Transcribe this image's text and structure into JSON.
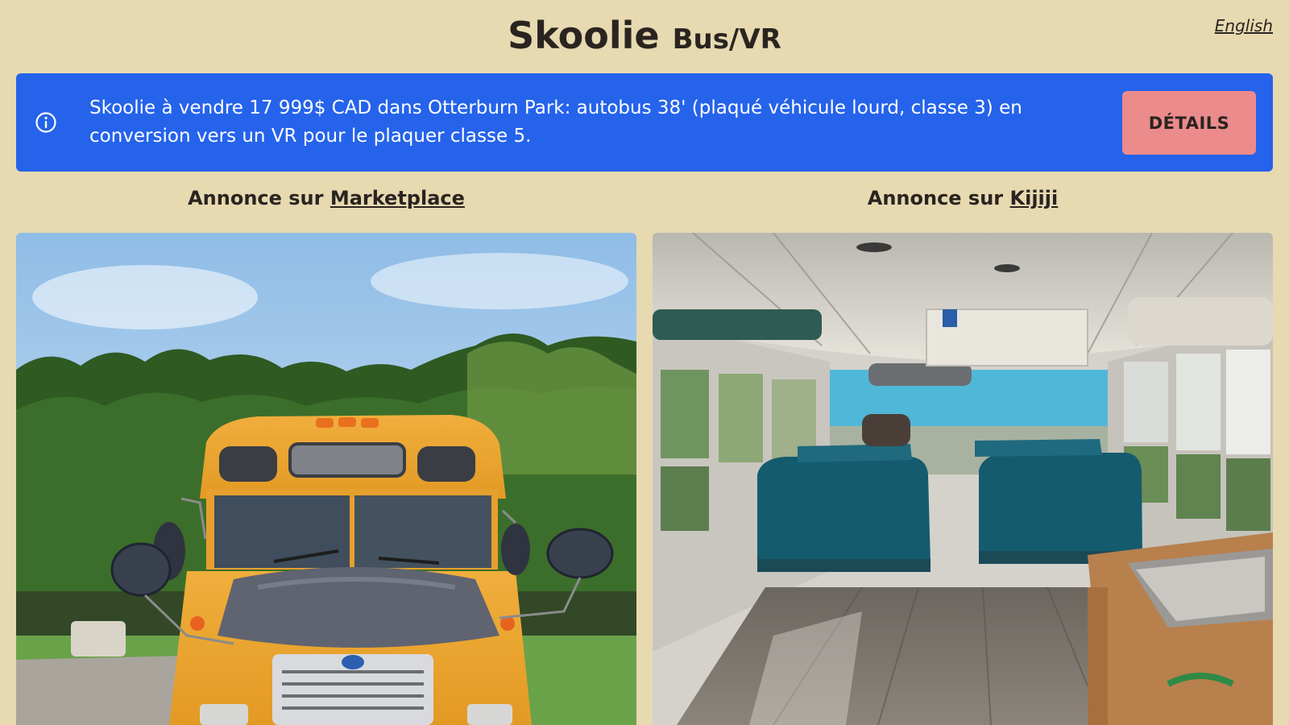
{
  "header": {
    "title_main": "Skoolie",
    "title_sub": "Bus/VR",
    "language_link": "English"
  },
  "banner": {
    "icon": "info-circle-icon",
    "text": "Skoolie à vendre 17 999$ CAD dans Otterburn Park: autobus 38' (plaqué véhicule lourd, classe 3) en conversion vers un VR pour le plaquer classe 5.",
    "details_label": "DÉTAILS",
    "background_color": "#2563eb",
    "button_color": "#ec8b8b"
  },
  "listings": [
    {
      "prefix": "Annonce sur ",
      "link_label": "Marketplace",
      "photo": "bus-exterior-front-photo"
    },
    {
      "prefix": "Annonce sur ",
      "link_label": "Kijiji",
      "photo": "bus-interior-photo"
    }
  ],
  "colors": {
    "page_background": "#e7d9b0",
    "text": "#2a2420"
  }
}
